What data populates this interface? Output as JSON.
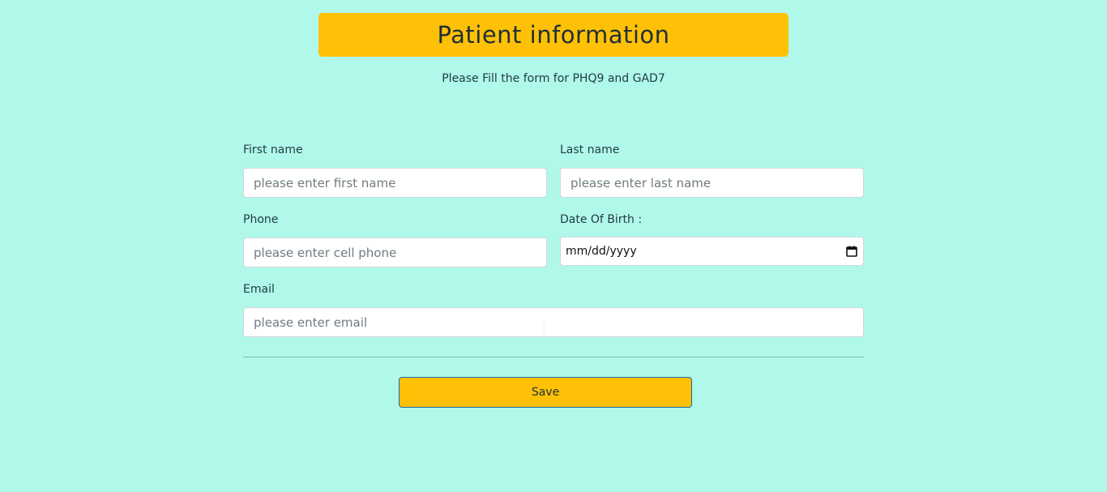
{
  "header": {
    "title": "Patient information",
    "subtitle": "Please Fill the form for PHQ9 and GAD7"
  },
  "form": {
    "first_name": {
      "label": "First name",
      "placeholder": "please enter first name",
      "value": ""
    },
    "last_name": {
      "label": "Last name",
      "placeholder": "please enter last name",
      "value": ""
    },
    "phone": {
      "label": "Phone",
      "placeholder": "please enter cell phone",
      "value": ""
    },
    "date_of_birth": {
      "label": "Date Of Birth :",
      "value": "mm/dd/yyyy",
      "icon": "calendar-icon"
    },
    "email": {
      "label": "Email",
      "placeholder": "please enter email",
      "value": ""
    },
    "save_label": "Save"
  },
  "colors": {
    "background": "#b0f8ea",
    "accent": "#ffc107",
    "text": "#1f3a44",
    "button_border": "#1c6aa8"
  }
}
